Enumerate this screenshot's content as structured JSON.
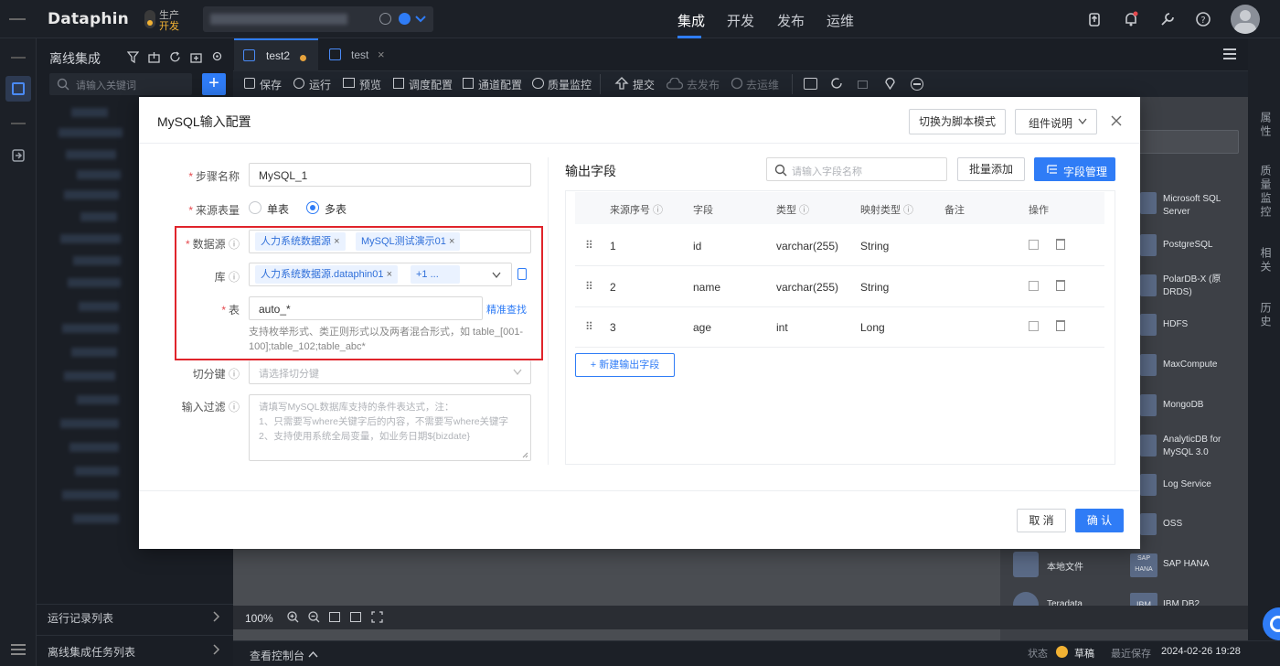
{
  "app": {
    "logo": "Dataphin",
    "env_prod": "生产",
    "env_dev": "开发"
  },
  "topnav": {
    "items": [
      "集成",
      "开发",
      "发布",
      "运维"
    ],
    "active": "集成"
  },
  "sidebar": {
    "title": "离线集成",
    "search_placeholder": "请输入关键词",
    "add_label": "+",
    "bottom_items": [
      "运行记录列表",
      "离线集成任务列表"
    ]
  },
  "tabs": [
    {
      "label": "test2",
      "modified": true
    },
    {
      "label": "test",
      "modified": false
    }
  ],
  "toolbar": {
    "items": [
      "保存",
      "运行",
      "预览",
      "调度配置",
      "通道配置",
      "质量监控",
      "提交",
      "去发布",
      "去运维"
    ]
  },
  "canvas": {
    "zoom": "100%",
    "console_label": "查看控制台"
  },
  "statusbar": {
    "status_label": "状态",
    "status_value": "草稿",
    "saved_label": "最近保存",
    "saved_time": "2024-02-26 19:28"
  },
  "right_strip": [
    "属性",
    "质量监控",
    "相关",
    "历史"
  ],
  "components": [
    {
      "name": "Microsoft SQL Server"
    },
    {
      "name": "PostgreSQL"
    },
    {
      "name": "PolarDB-X (原DRDS)"
    },
    {
      "name": "HDFS"
    },
    {
      "name": "MaxCompute"
    },
    {
      "name": "MongoDB"
    },
    {
      "name": "AnalyticDB for MySQL 3.0"
    },
    {
      "name": "Log Service"
    },
    {
      "name": "OSS"
    },
    {
      "name": "SAP HANA"
    },
    {
      "name": "IBM DB2"
    }
  ],
  "left_components": [
    "本地文件",
    "Teradata"
  ],
  "modal": {
    "title": "MySQL输入配置",
    "switch_script_label": "切换为脚本模式",
    "component_help_label": "组件说明",
    "form": {
      "step_name_label": "步骤名称",
      "step_name_value": "MySQL_1",
      "source_type_label": "来源表量",
      "source_type_options": [
        "单表",
        "多表"
      ],
      "source_type_selected": "多表",
      "datasource_label": "数据源",
      "datasource_tags": [
        "人力系统数据源",
        "MySQL测试演示01"
      ],
      "db_label": "库",
      "db_tags": [
        "人力系统数据源.dataphin01",
        "+1 ..."
      ],
      "table_label": "表",
      "table_value": "auto_*",
      "precise_search_label": "精准查找",
      "table_hint": "支持枚举形式、类正则形式以及两者混合形式，如 table_[001-100];table_102;table_abc*",
      "split_key_label": "切分键",
      "split_key_placeholder": "请选择切分键",
      "filter_label": "输入过滤",
      "filter_placeholder": "请填写MySQL数据库支持的条件表达式，注：\n1、只需要写where关键字后的内容，不需要写where关键字\n2、支持使用系统全局变量，如业务日期${bizdate}"
    },
    "output": {
      "title": "输出字段",
      "search_placeholder": "请输入字段名称",
      "batch_add_label": "批量添加",
      "field_manage_label": "字段管理",
      "columns": [
        "来源序号",
        "字段",
        "类型",
        "映射类型",
        "备注",
        "操作"
      ],
      "rows": [
        {
          "index": "1",
          "field": "id",
          "type": "varchar(255)",
          "mapping": "String",
          "note": ""
        },
        {
          "index": "2",
          "field": "name",
          "type": "varchar(255)",
          "mapping": "String",
          "note": ""
        },
        {
          "index": "3",
          "field": "age",
          "type": "int",
          "mapping": "Long",
          "note": ""
        }
      ],
      "new_field_label": "+ 新建输出字段"
    },
    "cancel_label": "取 消",
    "confirm_label": "确 认"
  },
  "colors": {
    "accent": "#2f7cf6",
    "highlight_border": "#e0242b",
    "required": "#e5484d"
  }
}
